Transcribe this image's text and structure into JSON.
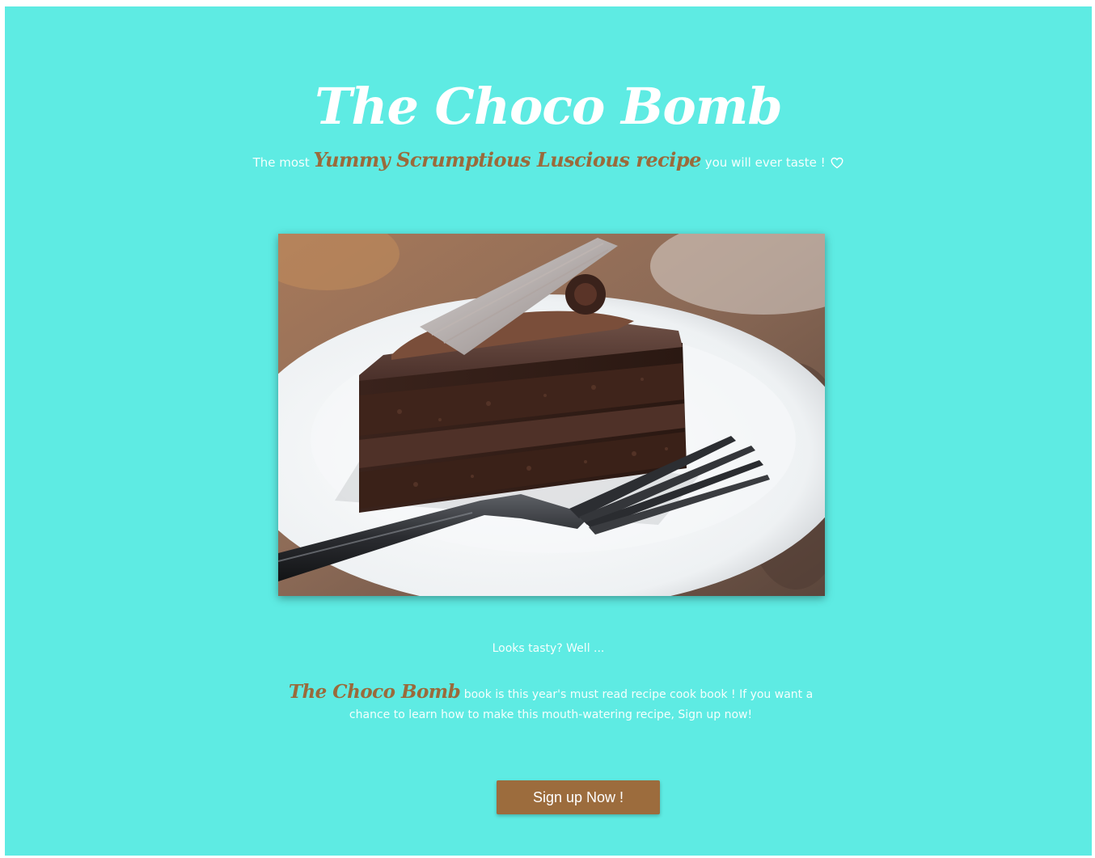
{
  "header": {
    "title": "The Choco Bomb"
  },
  "tagline": {
    "prefix": "The most",
    "highlight": "Yummy Scrumptious Luscious recipe",
    "suffix": "you will ever taste !",
    "icon": "heart-outline-icon"
  },
  "hero_image": {
    "subject": "slice of layered chocolate cake with a dark fork on a white plate"
  },
  "teaser": {
    "text": "Looks tasty? Well ..."
  },
  "pitch": {
    "highlight": "The Choco Bomb",
    "text": "book is this year's must read recipe cook book ! If you want a chance to learn how to make this mouth-watering recipe, Sign up now!"
  },
  "cta": {
    "label": "Sign up Now !"
  },
  "colors": {
    "background": "#5eebe3",
    "accent": "#9a6a3b",
    "button": "#9c6c3d",
    "title": "#ffffff"
  }
}
